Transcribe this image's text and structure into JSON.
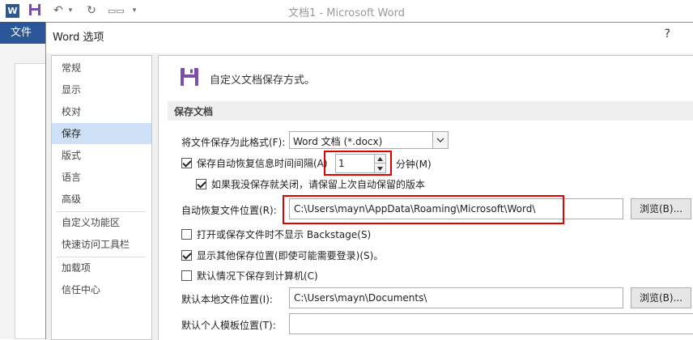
{
  "app": {
    "title": "文档1 - Microsoft Word",
    "word_icon_letter": "W",
    "file_tab": "文件"
  },
  "dialog": {
    "title": "Word 选项",
    "help": "?"
  },
  "nav": {
    "items": [
      "常规",
      "显示",
      "校对",
      "保存",
      "版式",
      "语言",
      "高级",
      "自定义功能区",
      "快速访问工具栏",
      "加载项",
      "信任中心"
    ],
    "active": "保存"
  },
  "content": {
    "header": "自定义文档保存方式。",
    "section_title": "保存文档",
    "format_label": "将文件保存为此格式(F):",
    "format_value": "Word 文档 (*.docx)",
    "autorecover_label": "保存自动恢复信息时间间隔(A)",
    "autorecover_value": "1",
    "autorecover_unit": "分钟(M)",
    "keep_last_label": "如果我没保存就关闭，请保留上次自动保留的版本",
    "autorecover_path_label": "自动恢复文件位置(R):",
    "autorecover_path": "C:\\Users\\mayn\\AppData\\Roaming\\Microsoft\\Word\\",
    "browse_label": "浏览(B)...",
    "no_backstage_label": "打开或保存文件时不显示 Backstage(S)",
    "show_other_label": "显示其他保存位置(即使可能需要登录)(S)。",
    "save_to_computer_label": "默认情况下保存到计算机(C)",
    "local_path_label": "默认本地文件位置(I):",
    "local_path": "C:\\Users\\mayn\\Documents\\",
    "template_path_label": "默认个人模板位置(T):",
    "template_path": ""
  },
  "checkboxes": {
    "autorecover": true,
    "keep_last": true,
    "no_backstage": false,
    "show_other": true,
    "save_to_computer": false
  },
  "colors": {
    "word_blue": "#2b579a",
    "highlight_red": "#e00000",
    "nav_active": "#cde0f5",
    "save_icon": "#7b4ea8"
  }
}
